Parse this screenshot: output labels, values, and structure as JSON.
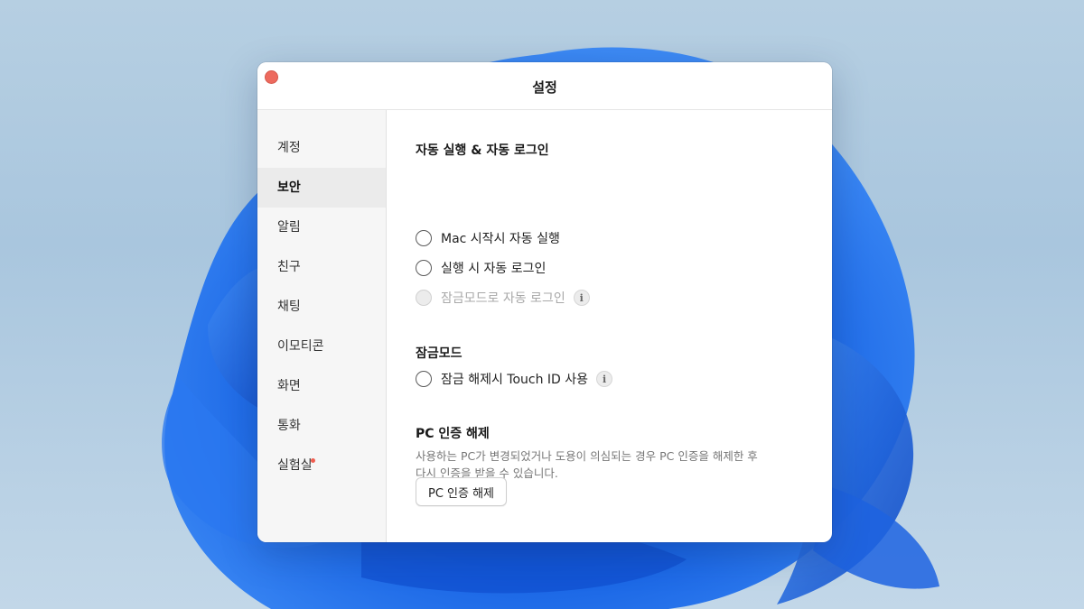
{
  "window": {
    "title": "설정"
  },
  "sidebar": {
    "items": [
      {
        "label": "계정",
        "active": false
      },
      {
        "label": "보안",
        "active": true
      },
      {
        "label": "알림",
        "active": false
      },
      {
        "label": "친구",
        "active": false
      },
      {
        "label": "채팅",
        "active": false
      },
      {
        "label": "이모티콘",
        "active": false
      },
      {
        "label": "화면",
        "active": false
      },
      {
        "label": "통화",
        "active": false
      },
      {
        "label": "실험실",
        "active": false,
        "badge": "new-dot"
      }
    ]
  },
  "content": {
    "auto_section": {
      "title": "자동 실행 & 자동 로그인",
      "options": [
        {
          "label": "Mac 시작시 자동 실행",
          "checked": false,
          "enabled": true
        },
        {
          "label": "실행 시 자동 로그인",
          "checked": false,
          "enabled": true
        },
        {
          "label": "잠금모드로 자동 로그인",
          "checked": false,
          "enabled": false,
          "info_icon": "i"
        }
      ]
    },
    "lock_section": {
      "title": "잠금모드",
      "options": [
        {
          "label": "잠금 해제시 Touch ID 사용",
          "checked": false,
          "enabled": true,
          "info_icon": "i"
        }
      ]
    },
    "pc_auth_section": {
      "title": "PC 인증 해제",
      "description_line1": "사용하는 PC가 변경되었거나 도용이 의심되는 경우 PC 인증을 해제한 후",
      "description_line2": "다시 인증을 받을 수 있습니다.",
      "button_label": "PC 인증 해제"
    }
  },
  "colors": {
    "close_button": "#ed6a5e",
    "sidebar_bg": "#f6f6f6",
    "sidebar_active_bg": "#ebebeb",
    "badge_dot": "#f05d4f",
    "wallpaper_bloom": "#1a66e6"
  }
}
